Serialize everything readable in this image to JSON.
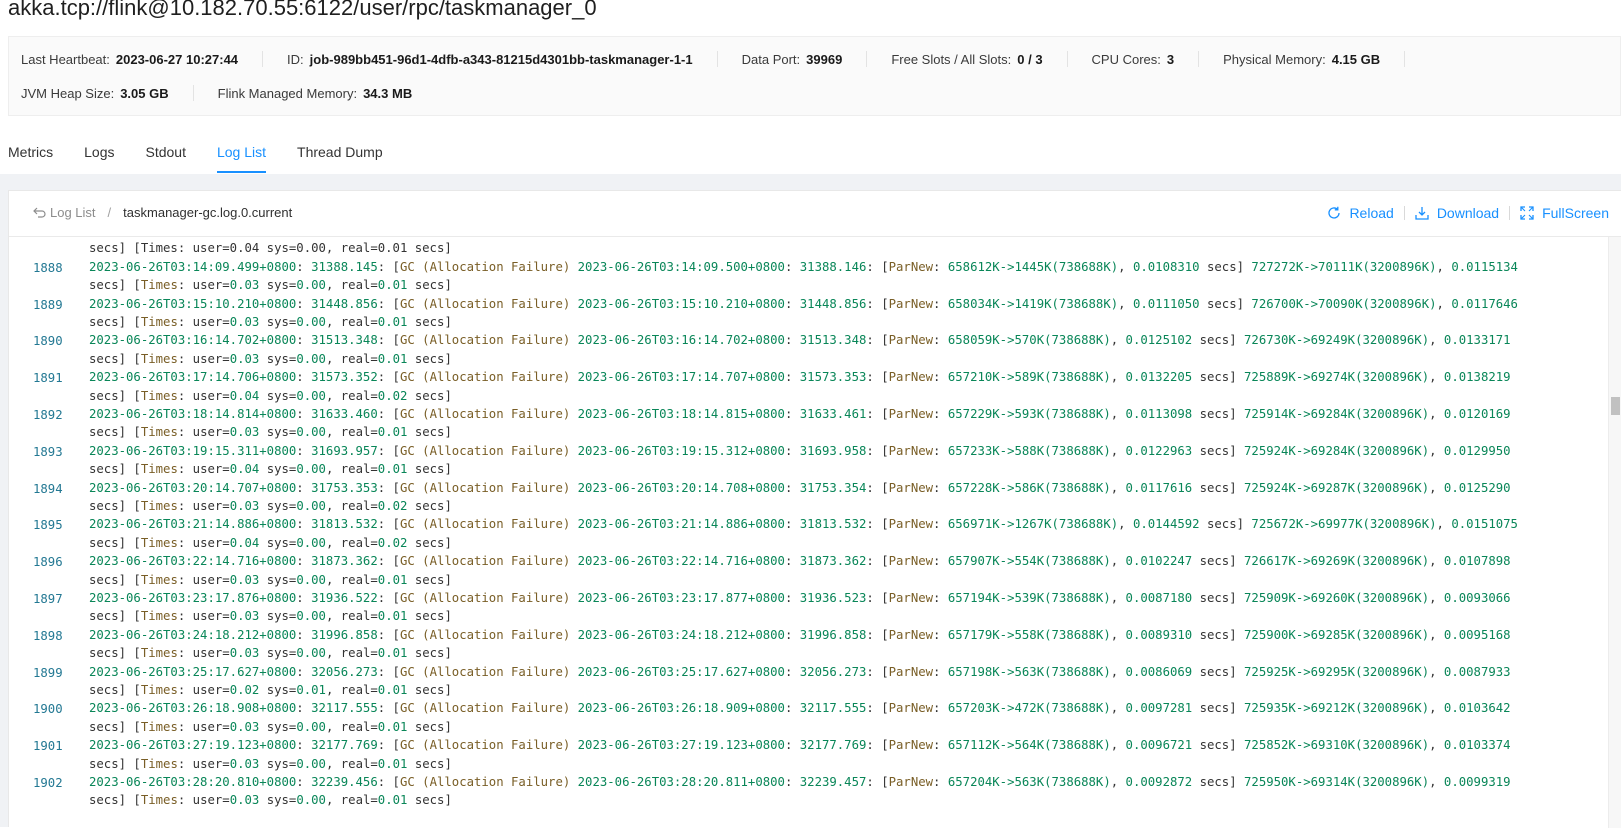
{
  "page": {
    "title": "akka.tcp://flink@10.182.70.55:6122/user/rpc/taskmanager_0"
  },
  "info": {
    "row1": [
      {
        "label": "Last Heartbeat:",
        "value": "2023-06-27 10:27:44"
      },
      {
        "label": "ID:",
        "value": "job-989bb451-96d1-4dfb-a343-81215d4301bb-taskmanager-1-1"
      },
      {
        "label": "Data Port:",
        "value": "39969"
      },
      {
        "label": "Free Slots / All Slots:",
        "value": "0 / 3"
      },
      {
        "label": "CPU Cores:",
        "value": "3"
      },
      {
        "label": "Physical Memory:",
        "value": "4.15 GB"
      }
    ],
    "row2": [
      {
        "label": "JVM Heap Size:",
        "value": "3.05 GB"
      },
      {
        "label": "Flink Managed Memory:",
        "value": "34.3 MB"
      }
    ]
  },
  "tabs": [
    {
      "label": "Metrics",
      "active": false
    },
    {
      "label": "Logs",
      "active": false
    },
    {
      "label": "Stdout",
      "active": false
    },
    {
      "label": "Log List",
      "active": true
    },
    {
      "label": "Thread Dump",
      "active": false
    }
  ],
  "breadcrumb": {
    "back_label": "Log List",
    "separator": "/",
    "current": "taskmanager-gc.log.0.current"
  },
  "actions": {
    "reload": "Reload",
    "download": "Download",
    "fullscreen": "FullScreen"
  },
  "colors": {
    "accent": "#1890ff",
    "line_number": "#237893",
    "number": "#098658",
    "keyword": "#795e26"
  },
  "log": {
    "partial_top_line": "secs] [Times: user=0.04 sys=0.00, real=0.01 secs]",
    "entries": [
      {
        "line": "1888",
        "ts1": "2023-06-26T03:14:09.499+0800",
        "up1": "31388.145",
        "ts2": "2023-06-26T03:14:09.500+0800",
        "up2": "31388.146",
        "young": "658612K->1445K(738688K)",
        "yt": "0.0108310",
        "heap": "727272K->70111K(3200896K)",
        "ht": "0.0115134",
        "user": "0.03",
        "sys": "0.00",
        "real": "0.01"
      },
      {
        "line": "1889",
        "ts1": "2023-06-26T03:15:10.210+0800",
        "up1": "31448.856",
        "ts2": "2023-06-26T03:15:10.210+0800",
        "up2": "31448.856",
        "young": "658034K->1419K(738688K)",
        "yt": "0.0111050",
        "heap": "726700K->70090K(3200896K)",
        "ht": "0.0117646",
        "user": "0.03",
        "sys": "0.00",
        "real": "0.01"
      },
      {
        "line": "1890",
        "ts1": "2023-06-26T03:16:14.702+0800",
        "up1": "31513.348",
        "ts2": "2023-06-26T03:16:14.702+0800",
        "up2": "31513.348",
        "young": "658059K->570K(738688K)",
        "yt": "0.0125102",
        "heap": "726730K->69249K(3200896K)",
        "ht": "0.0133171",
        "user": "0.03",
        "sys": "0.00",
        "real": "0.01"
      },
      {
        "line": "1891",
        "ts1": "2023-06-26T03:17:14.706+0800",
        "up1": "31573.352",
        "ts2": "2023-06-26T03:17:14.707+0800",
        "up2": "31573.353",
        "young": "657210K->589K(738688K)",
        "yt": "0.0132205",
        "heap": "725889K->69274K(3200896K)",
        "ht": "0.0138219",
        "user": "0.04",
        "sys": "0.00",
        "real": "0.02"
      },
      {
        "line": "1892",
        "ts1": "2023-06-26T03:18:14.814+0800",
        "up1": "31633.460",
        "ts2": "2023-06-26T03:18:14.815+0800",
        "up2": "31633.461",
        "young": "657229K->593K(738688K)",
        "yt": "0.0113098",
        "heap": "725914K->69284K(3200896K)",
        "ht": "0.0120169",
        "user": "0.03",
        "sys": "0.00",
        "real": "0.01"
      },
      {
        "line": "1893",
        "ts1": "2023-06-26T03:19:15.311+0800",
        "up1": "31693.957",
        "ts2": "2023-06-26T03:19:15.312+0800",
        "up2": "31693.958",
        "young": "657233K->588K(738688K)",
        "yt": "0.0122963",
        "heap": "725924K->69284K(3200896K)",
        "ht": "0.0129950",
        "user": "0.04",
        "sys": "0.00",
        "real": "0.01"
      },
      {
        "line": "1894",
        "ts1": "2023-06-26T03:20:14.707+0800",
        "up1": "31753.353",
        "ts2": "2023-06-26T03:20:14.708+0800",
        "up2": "31753.354",
        "young": "657228K->586K(738688K)",
        "yt": "0.0117616",
        "heap": "725924K->69287K(3200896K)",
        "ht": "0.0125290",
        "user": "0.03",
        "sys": "0.00",
        "real": "0.02"
      },
      {
        "line": "1895",
        "ts1": "2023-06-26T03:21:14.886+0800",
        "up1": "31813.532",
        "ts2": "2023-06-26T03:21:14.886+0800",
        "up2": "31813.532",
        "young": "656971K->1267K(738688K)",
        "yt": "0.0144592",
        "heap": "725672K->69977K(3200896K)",
        "ht": "0.0151075",
        "user": "0.04",
        "sys": "0.00",
        "real": "0.02"
      },
      {
        "line": "1896",
        "ts1": "2023-06-26T03:22:14.716+0800",
        "up1": "31873.362",
        "ts2": "2023-06-26T03:22:14.716+0800",
        "up2": "31873.362",
        "young": "657907K->554K(738688K)",
        "yt": "0.0102247",
        "heap": "726617K->69269K(3200896K)",
        "ht": "0.0107898",
        "user": "0.03",
        "sys": "0.00",
        "real": "0.01"
      },
      {
        "line": "1897",
        "ts1": "2023-06-26T03:23:17.876+0800",
        "up1": "31936.522",
        "ts2": "2023-06-26T03:23:17.877+0800",
        "up2": "31936.523",
        "young": "657194K->539K(738688K)",
        "yt": "0.0087180",
        "heap": "725909K->69260K(3200896K)",
        "ht": "0.0093066",
        "user": "0.03",
        "sys": "0.00",
        "real": "0.01"
      },
      {
        "line": "1898",
        "ts1": "2023-06-26T03:24:18.212+0800",
        "up1": "31996.858",
        "ts2": "2023-06-26T03:24:18.212+0800",
        "up2": "31996.858",
        "young": "657179K->558K(738688K)",
        "yt": "0.0089310",
        "heap": "725900K->69285K(3200896K)",
        "ht": "0.0095168",
        "user": "0.03",
        "sys": "0.00",
        "real": "0.01"
      },
      {
        "line": "1899",
        "ts1": "2023-06-26T03:25:17.627+0800",
        "up1": "32056.273",
        "ts2": "2023-06-26T03:25:17.627+0800",
        "up2": "32056.273",
        "young": "657198K->563K(738688K)",
        "yt": "0.0086069",
        "heap": "725925K->69295K(3200896K)",
        "ht": "0.0087933",
        "user": "0.02",
        "sys": "0.01",
        "real": "0.01"
      },
      {
        "line": "1900",
        "ts1": "2023-06-26T03:26:18.908+0800",
        "up1": "32117.555",
        "ts2": "2023-06-26T03:26:18.909+0800",
        "up2": "32117.555",
        "young": "657203K->472K(738688K)",
        "yt": "0.0097281",
        "heap": "725935K->69212K(3200896K)",
        "ht": "0.0103642",
        "user": "0.03",
        "sys": "0.00",
        "real": "0.01"
      },
      {
        "line": "1901",
        "ts1": "2023-06-26T03:27:19.123+0800",
        "up1": "32177.769",
        "ts2": "2023-06-26T03:27:19.123+0800",
        "up2": "32177.769",
        "young": "657112K->564K(738688K)",
        "yt": "0.0096721",
        "heap": "725852K->69310K(3200896K)",
        "ht": "0.0103374",
        "user": "0.03",
        "sys": "0.00",
        "real": "0.01"
      },
      {
        "line": "1902",
        "ts1": "2023-06-26T03:28:20.810+0800",
        "up1": "32239.456",
        "ts2": "2023-06-26T03:28:20.811+0800",
        "up2": "32239.457",
        "young": "657204K->563K(738688K)",
        "yt": "0.0092872",
        "heap": "725950K->69314K(3200896K)",
        "ht": "0.0099319",
        "user": "0.03",
        "sys": "0.00",
        "real": "0.01"
      }
    ]
  }
}
